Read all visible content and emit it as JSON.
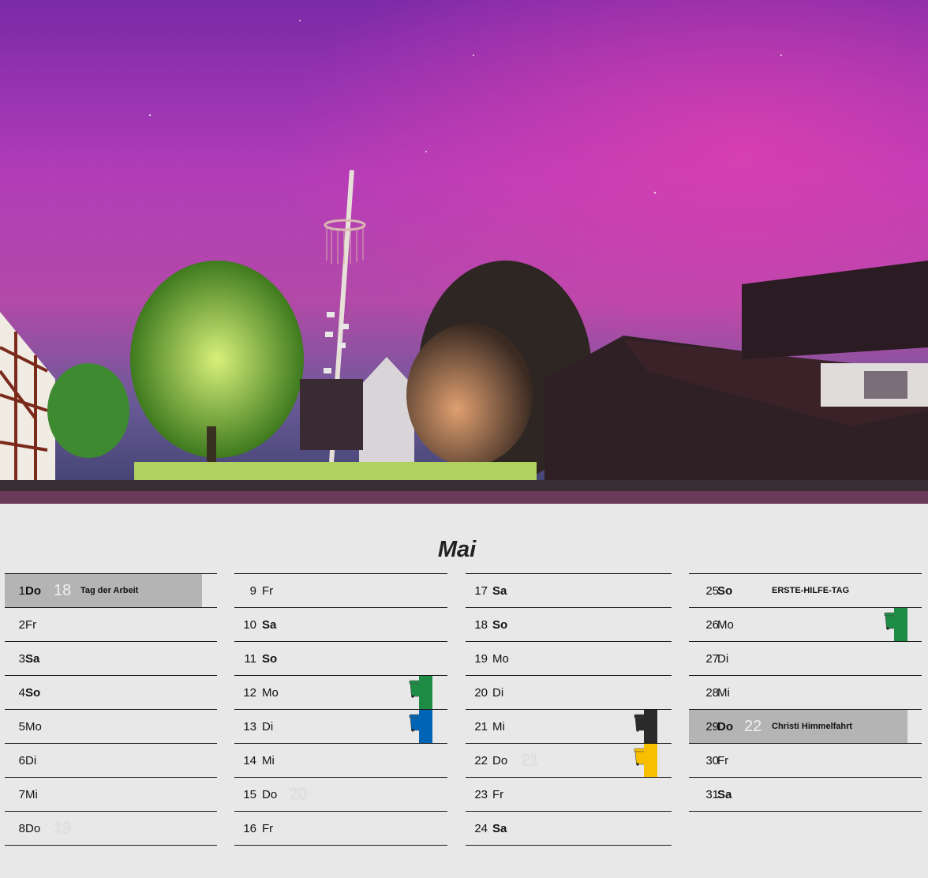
{
  "month": "Mai",
  "colors": {
    "highlight": "#b4b4b4",
    "bin_green": "#1e8c45",
    "bin_blue": "#0064b4",
    "bin_black": "#2a2a2a",
    "bin_yellow": "#f7bf00"
  },
  "columns": [
    [
      {
        "day": "1",
        "weekday": "Do",
        "bold": true,
        "kw": "18",
        "note": "Tag der Arbeit",
        "highlight": true
      },
      {
        "day": "2",
        "weekday": "Fr"
      },
      {
        "day": "3",
        "weekday": "Sa",
        "bold": true
      },
      {
        "day": "4",
        "weekday": "So",
        "bold": true
      },
      {
        "day": "5",
        "weekday": "Mo"
      },
      {
        "day": "6",
        "weekday": "Di"
      },
      {
        "day": "7",
        "weekday": "Mi"
      },
      {
        "day": "8",
        "weekday": "Do",
        "kw": "19",
        "kw_ghost": true
      }
    ],
    [
      {
        "day": "9",
        "weekday": "Fr"
      },
      {
        "day": "10",
        "weekday": "Sa",
        "bold": true
      },
      {
        "day": "11",
        "weekday": "So",
        "bold": true
      },
      {
        "day": "12",
        "weekday": "Mo",
        "bin": "green",
        "bin_icon": "green-bin-icon"
      },
      {
        "day": "13",
        "weekday": "Di",
        "bin": "blue",
        "bin_icon": "blue-bin-icon"
      },
      {
        "day": "14",
        "weekday": "Mi"
      },
      {
        "day": "15",
        "weekday": "Do",
        "kw": "20",
        "kw_ghost": true
      },
      {
        "day": "16",
        "weekday": "Fr"
      }
    ],
    [
      {
        "day": "17",
        "weekday": "Sa",
        "bold": true
      },
      {
        "day": "18",
        "weekday": "So",
        "bold": true
      },
      {
        "day": "19",
        "weekday": "Mo"
      },
      {
        "day": "20",
        "weekday": "Di"
      },
      {
        "day": "21",
        "weekday": "Mi",
        "bin": "black",
        "bin_icon": "black-bin-icon"
      },
      {
        "day": "22",
        "weekday": "Do",
        "kw": "21",
        "kw_ghost": true,
        "bin": "yellow",
        "bin_icon": "yellow-bin-icon"
      },
      {
        "day": "23",
        "weekday": "Fr"
      },
      {
        "day": "24",
        "weekday": "Sa",
        "bold": true
      }
    ],
    [
      {
        "day": "25",
        "weekday": "So",
        "bold": true,
        "note": "ERSTE-HILFE-TAG"
      },
      {
        "day": "26",
        "weekday": "Mo",
        "bin": "green",
        "bin_icon": "green-bin-icon"
      },
      {
        "day": "27",
        "weekday": "Di"
      },
      {
        "day": "28",
        "weekday": "Mi"
      },
      {
        "day": "29",
        "weekday": "Do",
        "bold": true,
        "kw": "22",
        "note": "Christi Himmelfahrt",
        "highlight": true
      },
      {
        "day": "30",
        "weekday": "Fr"
      },
      {
        "day": "31",
        "weekday": "Sa",
        "bold": true
      }
    ]
  ]
}
